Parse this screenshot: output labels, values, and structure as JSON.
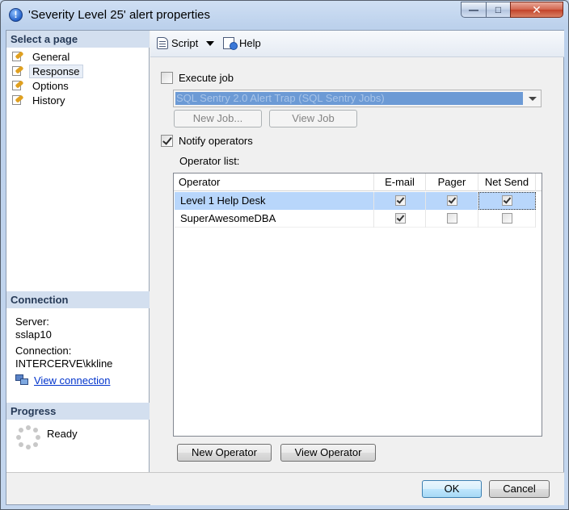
{
  "window": {
    "title": "'Severity Level 25' alert properties",
    "close_glyph": "✕",
    "max_glyph": "□",
    "min_glyph": "—",
    "title_icon_glyph": "!"
  },
  "sidebar": {
    "header": "Select a page",
    "items": [
      {
        "label": "General",
        "icon": "page-settings-icon",
        "selected": false
      },
      {
        "label": "Response",
        "icon": "page-settings-icon",
        "selected": true
      },
      {
        "label": "Options",
        "icon": "page-settings-icon",
        "selected": false
      },
      {
        "label": "History",
        "icon": "page-settings-icon",
        "selected": false
      }
    ],
    "connection": {
      "header": "Connection",
      "server_label": "Server:",
      "server_value": "sslap10",
      "connection_label": "Connection:",
      "connection_value": "INTERCERVE\\kkline",
      "view_link": "View connection"
    },
    "progress": {
      "header": "Progress",
      "status": "Ready"
    }
  },
  "toolbar": {
    "script_label": "Script",
    "help_label": "Help"
  },
  "response": {
    "execute_job": {
      "label": "Execute job",
      "checked": false
    },
    "job_combo": {
      "value": "SQL Sentry 2.0 Alert Trap (SQL Sentry Jobs)"
    },
    "new_job_button": "New Job...",
    "view_job_button": "View Job",
    "notify_operators": {
      "label": "Notify operators",
      "checked": true
    },
    "operator_list_label": "Operator list:",
    "columns": [
      "Operator",
      "E-mail",
      "Pager",
      "Net Send"
    ],
    "rows": [
      {
        "operator": "Level 1 Help Desk",
        "email": true,
        "pager": true,
        "net_send": true,
        "selected": true
      },
      {
        "operator": "SuperAwesomeDBA",
        "email": true,
        "pager": false,
        "net_send": false,
        "selected": false
      }
    ],
    "new_operator_button": "New Operator",
    "view_operator_button": "View Operator"
  },
  "footer": {
    "ok_button": "OK",
    "cancel_button": "Cancel"
  }
}
